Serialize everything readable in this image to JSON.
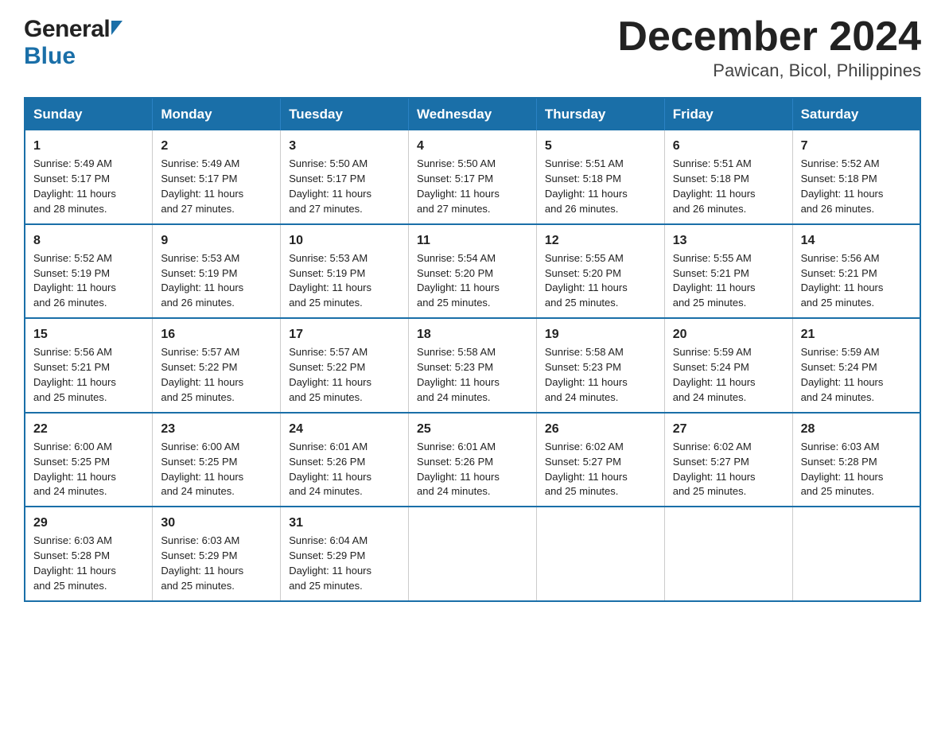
{
  "logo": {
    "general": "General",
    "blue": "Blue"
  },
  "title": {
    "month": "December 2024",
    "location": "Pawican, Bicol, Philippines"
  },
  "days_header": [
    "Sunday",
    "Monday",
    "Tuesday",
    "Wednesday",
    "Thursday",
    "Friday",
    "Saturday"
  ],
  "weeks": [
    [
      {
        "day": "1",
        "sunrise": "5:49 AM",
        "sunset": "5:17 PM",
        "daylight": "11 hours and 28 minutes."
      },
      {
        "day": "2",
        "sunrise": "5:49 AM",
        "sunset": "5:17 PM",
        "daylight": "11 hours and 27 minutes."
      },
      {
        "day": "3",
        "sunrise": "5:50 AM",
        "sunset": "5:17 PM",
        "daylight": "11 hours and 27 minutes."
      },
      {
        "day": "4",
        "sunrise": "5:50 AM",
        "sunset": "5:17 PM",
        "daylight": "11 hours and 27 minutes."
      },
      {
        "day": "5",
        "sunrise": "5:51 AM",
        "sunset": "5:18 PM",
        "daylight": "11 hours and 26 minutes."
      },
      {
        "day": "6",
        "sunrise": "5:51 AM",
        "sunset": "5:18 PM",
        "daylight": "11 hours and 26 minutes."
      },
      {
        "day": "7",
        "sunrise": "5:52 AM",
        "sunset": "5:18 PM",
        "daylight": "11 hours and 26 minutes."
      }
    ],
    [
      {
        "day": "8",
        "sunrise": "5:52 AM",
        "sunset": "5:19 PM",
        "daylight": "11 hours and 26 minutes."
      },
      {
        "day": "9",
        "sunrise": "5:53 AM",
        "sunset": "5:19 PM",
        "daylight": "11 hours and 26 minutes."
      },
      {
        "day": "10",
        "sunrise": "5:53 AM",
        "sunset": "5:19 PM",
        "daylight": "11 hours and 25 minutes."
      },
      {
        "day": "11",
        "sunrise": "5:54 AM",
        "sunset": "5:20 PM",
        "daylight": "11 hours and 25 minutes."
      },
      {
        "day": "12",
        "sunrise": "5:55 AM",
        "sunset": "5:20 PM",
        "daylight": "11 hours and 25 minutes."
      },
      {
        "day": "13",
        "sunrise": "5:55 AM",
        "sunset": "5:21 PM",
        "daylight": "11 hours and 25 minutes."
      },
      {
        "day": "14",
        "sunrise": "5:56 AM",
        "sunset": "5:21 PM",
        "daylight": "11 hours and 25 minutes."
      }
    ],
    [
      {
        "day": "15",
        "sunrise": "5:56 AM",
        "sunset": "5:21 PM",
        "daylight": "11 hours and 25 minutes."
      },
      {
        "day": "16",
        "sunrise": "5:57 AM",
        "sunset": "5:22 PM",
        "daylight": "11 hours and 25 minutes."
      },
      {
        "day": "17",
        "sunrise": "5:57 AM",
        "sunset": "5:22 PM",
        "daylight": "11 hours and 25 minutes."
      },
      {
        "day": "18",
        "sunrise": "5:58 AM",
        "sunset": "5:23 PM",
        "daylight": "11 hours and 24 minutes."
      },
      {
        "day": "19",
        "sunrise": "5:58 AM",
        "sunset": "5:23 PM",
        "daylight": "11 hours and 24 minutes."
      },
      {
        "day": "20",
        "sunrise": "5:59 AM",
        "sunset": "5:24 PM",
        "daylight": "11 hours and 24 minutes."
      },
      {
        "day": "21",
        "sunrise": "5:59 AM",
        "sunset": "5:24 PM",
        "daylight": "11 hours and 24 minutes."
      }
    ],
    [
      {
        "day": "22",
        "sunrise": "6:00 AM",
        "sunset": "5:25 PM",
        "daylight": "11 hours and 24 minutes."
      },
      {
        "day": "23",
        "sunrise": "6:00 AM",
        "sunset": "5:25 PM",
        "daylight": "11 hours and 24 minutes."
      },
      {
        "day": "24",
        "sunrise": "6:01 AM",
        "sunset": "5:26 PM",
        "daylight": "11 hours and 24 minutes."
      },
      {
        "day": "25",
        "sunrise": "6:01 AM",
        "sunset": "5:26 PM",
        "daylight": "11 hours and 24 minutes."
      },
      {
        "day": "26",
        "sunrise": "6:02 AM",
        "sunset": "5:27 PM",
        "daylight": "11 hours and 25 minutes."
      },
      {
        "day": "27",
        "sunrise": "6:02 AM",
        "sunset": "5:27 PM",
        "daylight": "11 hours and 25 minutes."
      },
      {
        "day": "28",
        "sunrise": "6:03 AM",
        "sunset": "5:28 PM",
        "daylight": "11 hours and 25 minutes."
      }
    ],
    [
      {
        "day": "29",
        "sunrise": "6:03 AM",
        "sunset": "5:28 PM",
        "daylight": "11 hours and 25 minutes."
      },
      {
        "day": "30",
        "sunrise": "6:03 AM",
        "sunset": "5:29 PM",
        "daylight": "11 hours and 25 minutes."
      },
      {
        "day": "31",
        "sunrise": "6:04 AM",
        "sunset": "5:29 PM",
        "daylight": "11 hours and 25 minutes."
      },
      null,
      null,
      null,
      null
    ]
  ],
  "labels": {
    "sunrise": "Sunrise:",
    "sunset": "Sunset:",
    "daylight": "Daylight:"
  }
}
